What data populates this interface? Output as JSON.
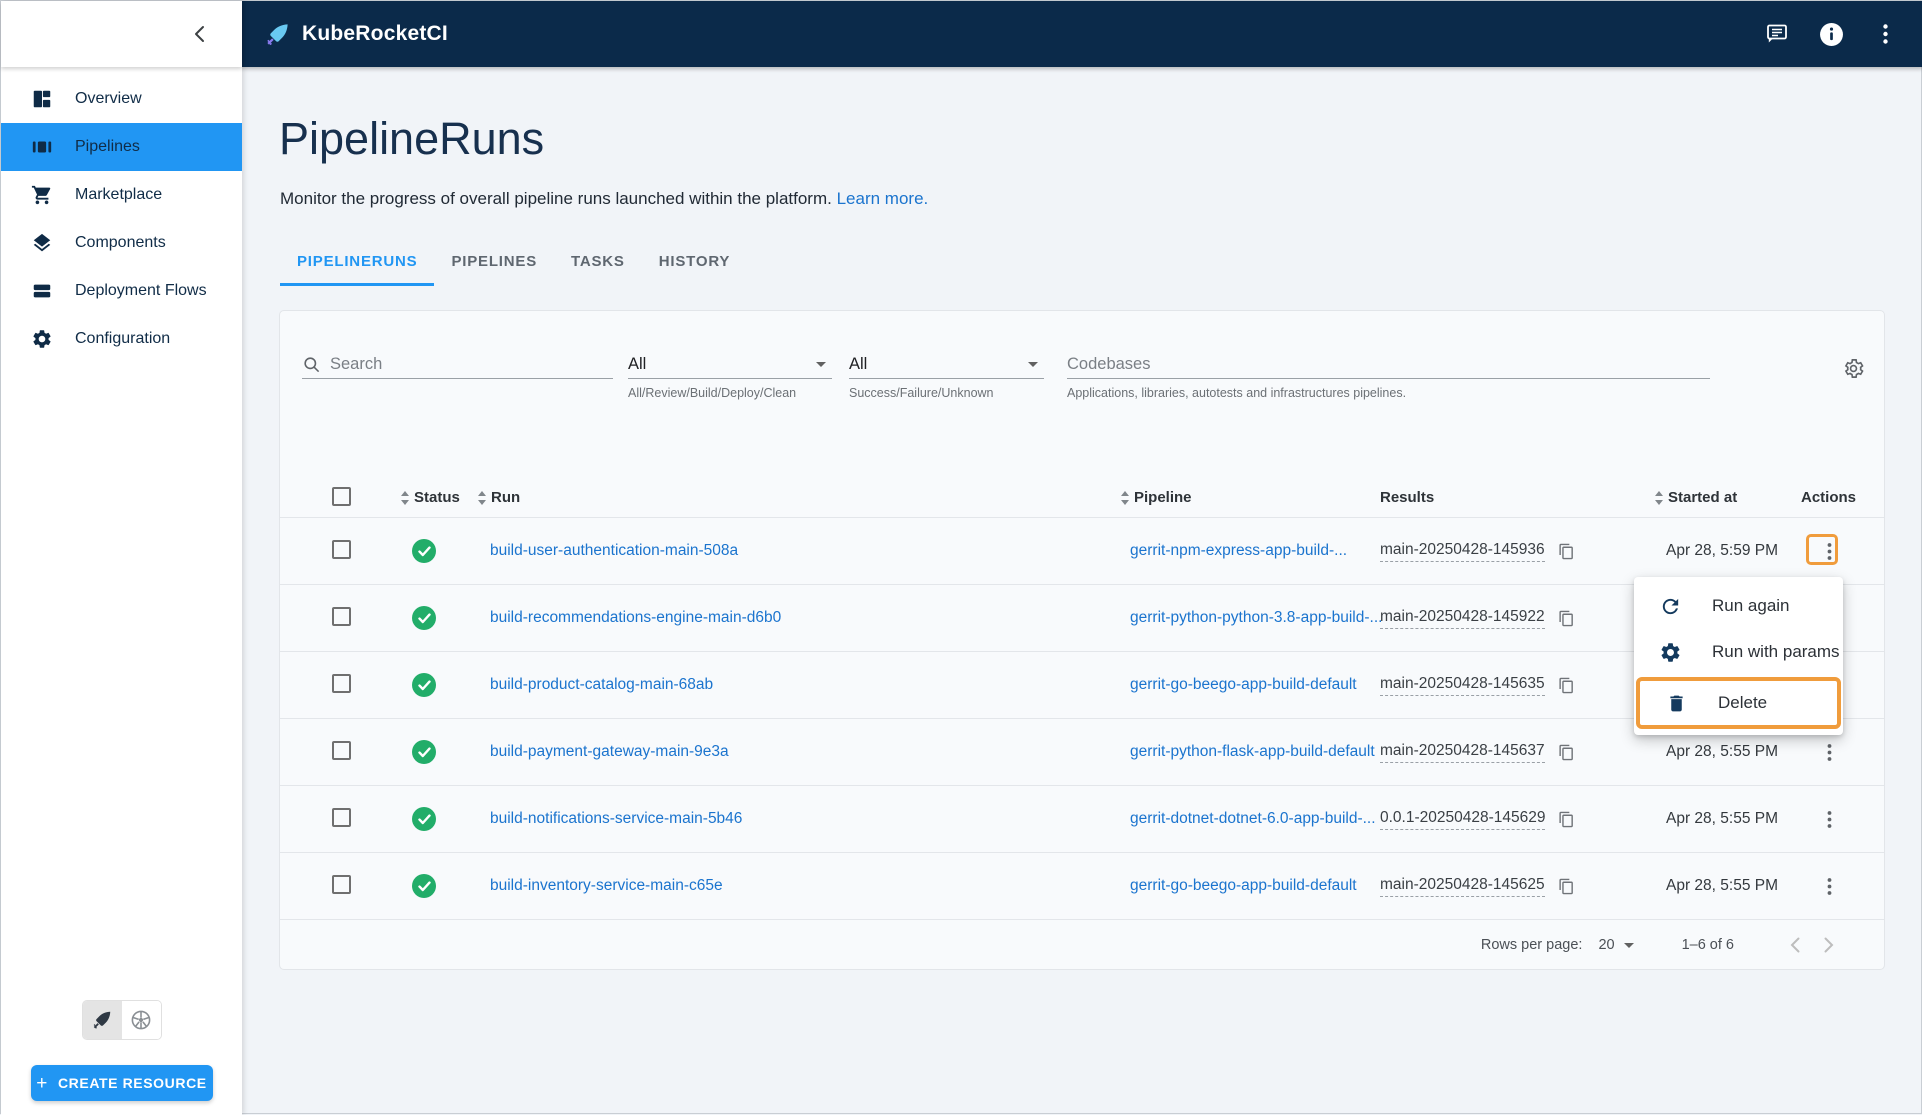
{
  "app": {
    "title": "KubeRocketCI"
  },
  "colors": {
    "accent": "#2196f3",
    "header_navy": "#0b2a4a",
    "success_green": "#22ad69",
    "link_blue": "#1b74ce",
    "highlight_orange": "#f09c3c"
  },
  "icons": {
    "logo": "rocket-quill",
    "header": [
      "chat-bubble",
      "info-circle",
      "kebab-menu"
    ],
    "env_toggle": [
      "rocket-quill",
      "kubernetes-wheel"
    ]
  },
  "sidebar": {
    "items": [
      {
        "label": "Overview"
      },
      {
        "label": "Pipelines"
      },
      {
        "label": "Marketplace"
      },
      {
        "label": "Components"
      },
      {
        "label": "Deployment Flows"
      },
      {
        "label": "Configuration"
      }
    ],
    "create_button": "CREATE RESOURCE"
  },
  "page": {
    "title": "PipelineRuns",
    "subtitle": "Monitor the progress of overall pipeline runs launched within the platform.",
    "learn_more": "Learn more.",
    "tabs": [
      {
        "label": "PIPELINERUNS"
      },
      {
        "label": "PIPELINES"
      },
      {
        "label": "TASKS"
      },
      {
        "label": "HISTORY"
      }
    ]
  },
  "filters": {
    "search_placeholder": "Search",
    "type_select": {
      "value": "All",
      "helper": "All/Review/Build/Deploy/Clean"
    },
    "status_select": {
      "value": "All",
      "helper": "Success/Failure/Unknown"
    },
    "codebases": {
      "placeholder": "Codebases",
      "helper": "Applications, libraries, autotests and infrastructures pipelines."
    }
  },
  "table": {
    "columns": {
      "status": "Status",
      "run": "Run",
      "pipeline": "Pipeline",
      "results": "Results",
      "started": "Started at",
      "actions": "Actions"
    },
    "rows": [
      {
        "run": "build-user-authentication-main-508a",
        "pipeline": "gerrit-npm-express-app-build-...",
        "results": "main-20250428-145936",
        "started": "Apr 28, 5:59 PM"
      },
      {
        "run": "build-recommendations-engine-main-d6b0",
        "pipeline": "gerrit-python-python-3.8-app-build-...",
        "results": "main-20250428-145922",
        "started": ""
      },
      {
        "run": "build-product-catalog-main-68ab",
        "pipeline": "gerrit-go-beego-app-build-default",
        "results": "main-20250428-145635",
        "started": ""
      },
      {
        "run": "build-payment-gateway-main-9e3a",
        "pipeline": "gerrit-python-flask-app-build-default",
        "results": "main-20250428-145637",
        "started": "Apr 28, 5:55 PM"
      },
      {
        "run": "build-notifications-service-main-5b46",
        "pipeline": "gerrit-dotnet-dotnet-6.0-app-build-...",
        "results": "0.0.1-20250428-145629",
        "started": "Apr 28, 5:55 PM"
      },
      {
        "run": "build-inventory-service-main-c65e",
        "pipeline": "gerrit-go-beego-app-build-default",
        "results": "main-20250428-145625",
        "started": "Apr 28, 5:55 PM"
      }
    ]
  },
  "context_menu": {
    "items": [
      {
        "label": "Run again"
      },
      {
        "label": "Run with params"
      },
      {
        "label": "Delete"
      }
    ]
  },
  "pagination": {
    "rows_per_page_label": "Rows per page:",
    "rows_per_page": "20",
    "range": "1–6 of 6"
  }
}
